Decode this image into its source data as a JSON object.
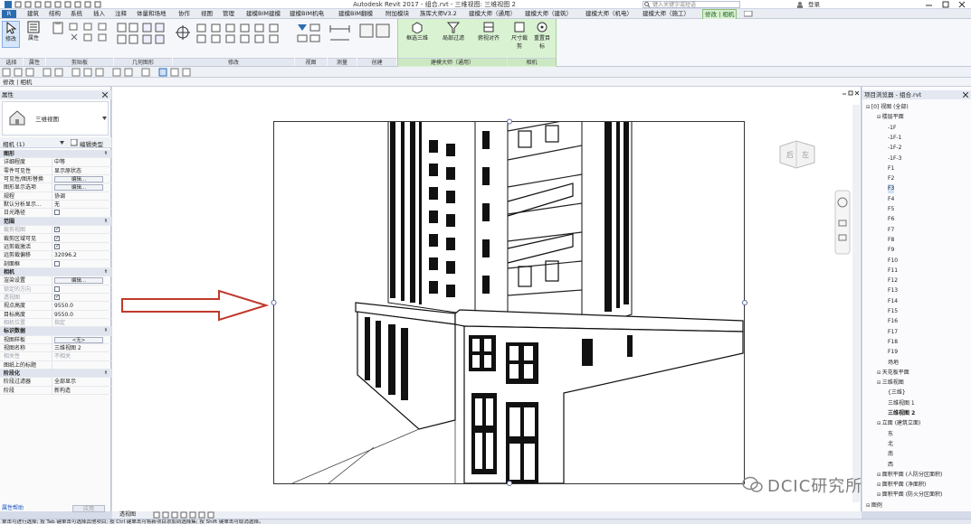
{
  "titlebar": {
    "title": "Autodesk Revit 2017 -   组合.rvt - 三维视图: 三维视图 2",
    "search_placeholder": "键入关键字或短语",
    "login": "登录"
  },
  "tabs": [
    "建筑",
    "结构",
    "系统",
    "插入",
    "注释",
    "体量和场地",
    "协作",
    "视图",
    "管理",
    "建模BIM建模",
    "建模BIM机电",
    "建模BIM翻模",
    "附加模块",
    "族库大师V3.2",
    "建模大师（通用）",
    "建模大师（建筑）",
    "建模大师（机电）",
    "建模大师（施工）",
    "修改 | 相机"
  ],
  "active_tab": "修改 | 相机",
  "ribbon": {
    "modify_button": "修改",
    "properties_button": "属性",
    "groups": [
      "选择",
      "属性",
      "剪贴板",
      "几何图形",
      "修改",
      "视图",
      "测量",
      "创建",
      "建模大师（通用）",
      "相机"
    ],
    "ctx_buttons": [
      "框选三维",
      "局部过滤",
      "俯视对齐"
    ],
    "camera_buttons": [
      "尺寸裁剪",
      "重置目标"
    ]
  },
  "context_bar": "修改 | 相机",
  "properties": {
    "header": "属性",
    "type_name": "三维视图",
    "type_selector": "相机 (1)",
    "edit_type": "编辑类型",
    "rows": [
      {
        "k": "图形",
        "v": "",
        "section": true
      },
      {
        "k": "详细程度",
        "v": "中等"
      },
      {
        "k": "零件可见性",
        "v": "显示原状态"
      },
      {
        "k": "可见性/图形替换",
        "v": "编辑...",
        "btn": true
      },
      {
        "k": "图形显示选项",
        "v": "编辑...",
        "btn": true
      },
      {
        "k": "规程",
        "v": "协调"
      },
      {
        "k": "默认分析显示...",
        "v": "无"
      },
      {
        "k": "日光路径",
        "v": "",
        "chk": "off"
      },
      {
        "k": "范围",
        "v": "",
        "section": true
      },
      {
        "k": "裁剪视图",
        "v": "",
        "chk": "on",
        "dim": true
      },
      {
        "k": "裁剪区域可见",
        "v": "",
        "chk": "on"
      },
      {
        "k": "远剪裁激活",
        "v": "",
        "chk": "on"
      },
      {
        "k": "远剪裁偏移",
        "v": "32096.2"
      },
      {
        "k": "剖面框",
        "v": "",
        "chk": "off"
      },
      {
        "k": "相机",
        "v": "",
        "section": true
      },
      {
        "k": "渲染设置",
        "v": "编辑...",
        "btn": true
      },
      {
        "k": "锁定的方向",
        "v": "",
        "chk": "off",
        "dim": true
      },
      {
        "k": "透视图",
        "v": "",
        "chk": "on",
        "dim": true
      },
      {
        "k": "视点高度",
        "v": "9550.0"
      },
      {
        "k": "目标高度",
        "v": "9550.0"
      },
      {
        "k": "相机位置",
        "v": "指定",
        "dim": true
      },
      {
        "k": "标识数据",
        "v": "",
        "section": true
      },
      {
        "k": "视图样板",
        "v": "<无>",
        "btn": true
      },
      {
        "k": "视图名称",
        "v": "三维视图 2"
      },
      {
        "k": "相关性",
        "v": "不相关",
        "dim": true
      },
      {
        "k": "图纸上的标题",
        "v": ""
      },
      {
        "k": "阶段化",
        "v": "",
        "section": true
      },
      {
        "k": "阶段过滤器",
        "v": "全部显示"
      },
      {
        "k": "阶段",
        "v": "新构造"
      }
    ],
    "help_link": "属性帮助",
    "apply_button": "应用"
  },
  "viewcube": {
    "face1": "后",
    "face2": "左"
  },
  "browser": {
    "header": "项目浏览器 - 组合.rvt",
    "nodes": [
      {
        "t": "[0] 视图 (全部)",
        "lvl": 0
      },
      {
        "t": "楼层平面",
        "lvl": 1
      },
      {
        "t": "-1F",
        "lvl": 2
      },
      {
        "t": "-1F-1",
        "lvl": 2
      },
      {
        "t": "-1F-2",
        "lvl": 2
      },
      {
        "t": "-1F-3",
        "lvl": 2
      },
      {
        "t": "F1",
        "lvl": 2
      },
      {
        "t": "F2",
        "lvl": 2
      },
      {
        "t": "F3",
        "lvl": 2,
        "sel": true
      },
      {
        "t": "F4",
        "lvl": 2
      },
      {
        "t": "F5",
        "lvl": 2
      },
      {
        "t": "F6",
        "lvl": 2
      },
      {
        "t": "F7",
        "lvl": 2
      },
      {
        "t": "F8",
        "lvl": 2
      },
      {
        "t": "F9",
        "lvl": 2
      },
      {
        "t": "F10",
        "lvl": 2
      },
      {
        "t": "F11",
        "lvl": 2
      },
      {
        "t": "F12",
        "lvl": 2
      },
      {
        "t": "F13",
        "lvl": 2
      },
      {
        "t": "F14",
        "lvl": 2
      },
      {
        "t": "F15",
        "lvl": 2
      },
      {
        "t": "F16",
        "lvl": 2
      },
      {
        "t": "F17",
        "lvl": 2
      },
      {
        "t": "F18",
        "lvl": 2
      },
      {
        "t": "F19",
        "lvl": 2
      },
      {
        "t": "场地",
        "lvl": 2
      },
      {
        "t": "天花板平面",
        "lvl": 1
      },
      {
        "t": "三维视图",
        "lvl": 1
      },
      {
        "t": "{三维}",
        "lvl": 2
      },
      {
        "t": "三维视图 1",
        "lvl": 2
      },
      {
        "t": "三维视图 2",
        "lvl": 2,
        "bold": true
      },
      {
        "t": "立面 (建筑立面)",
        "lvl": 1
      },
      {
        "t": "东",
        "lvl": 2
      },
      {
        "t": "北",
        "lvl": 2
      },
      {
        "t": "南",
        "lvl": 2
      },
      {
        "t": "西",
        "lvl": 2
      },
      {
        "t": "面积平面 (人防分区面积)",
        "lvl": 1
      },
      {
        "t": "面积平面 (净面积)",
        "lvl": 1
      },
      {
        "t": "面积平面 (防火分区面积)",
        "lvl": 1
      },
      {
        "t": "图例",
        "lvl": 0
      }
    ]
  },
  "viewbar": {
    "label": "透视图"
  },
  "statusbar": "单击可进行选择; 按 Tab 键单击可选择其他项目; 按 Ctrl 键单击可将新项目添加到选择集; 按 Shift 键单击可取消选择。",
  "watermark": "DCIC研究所",
  "colors": {
    "accent_green": "#d9f2d2",
    "arrow_red": "#c0392b",
    "selection_blue": "#cfe0f7"
  }
}
